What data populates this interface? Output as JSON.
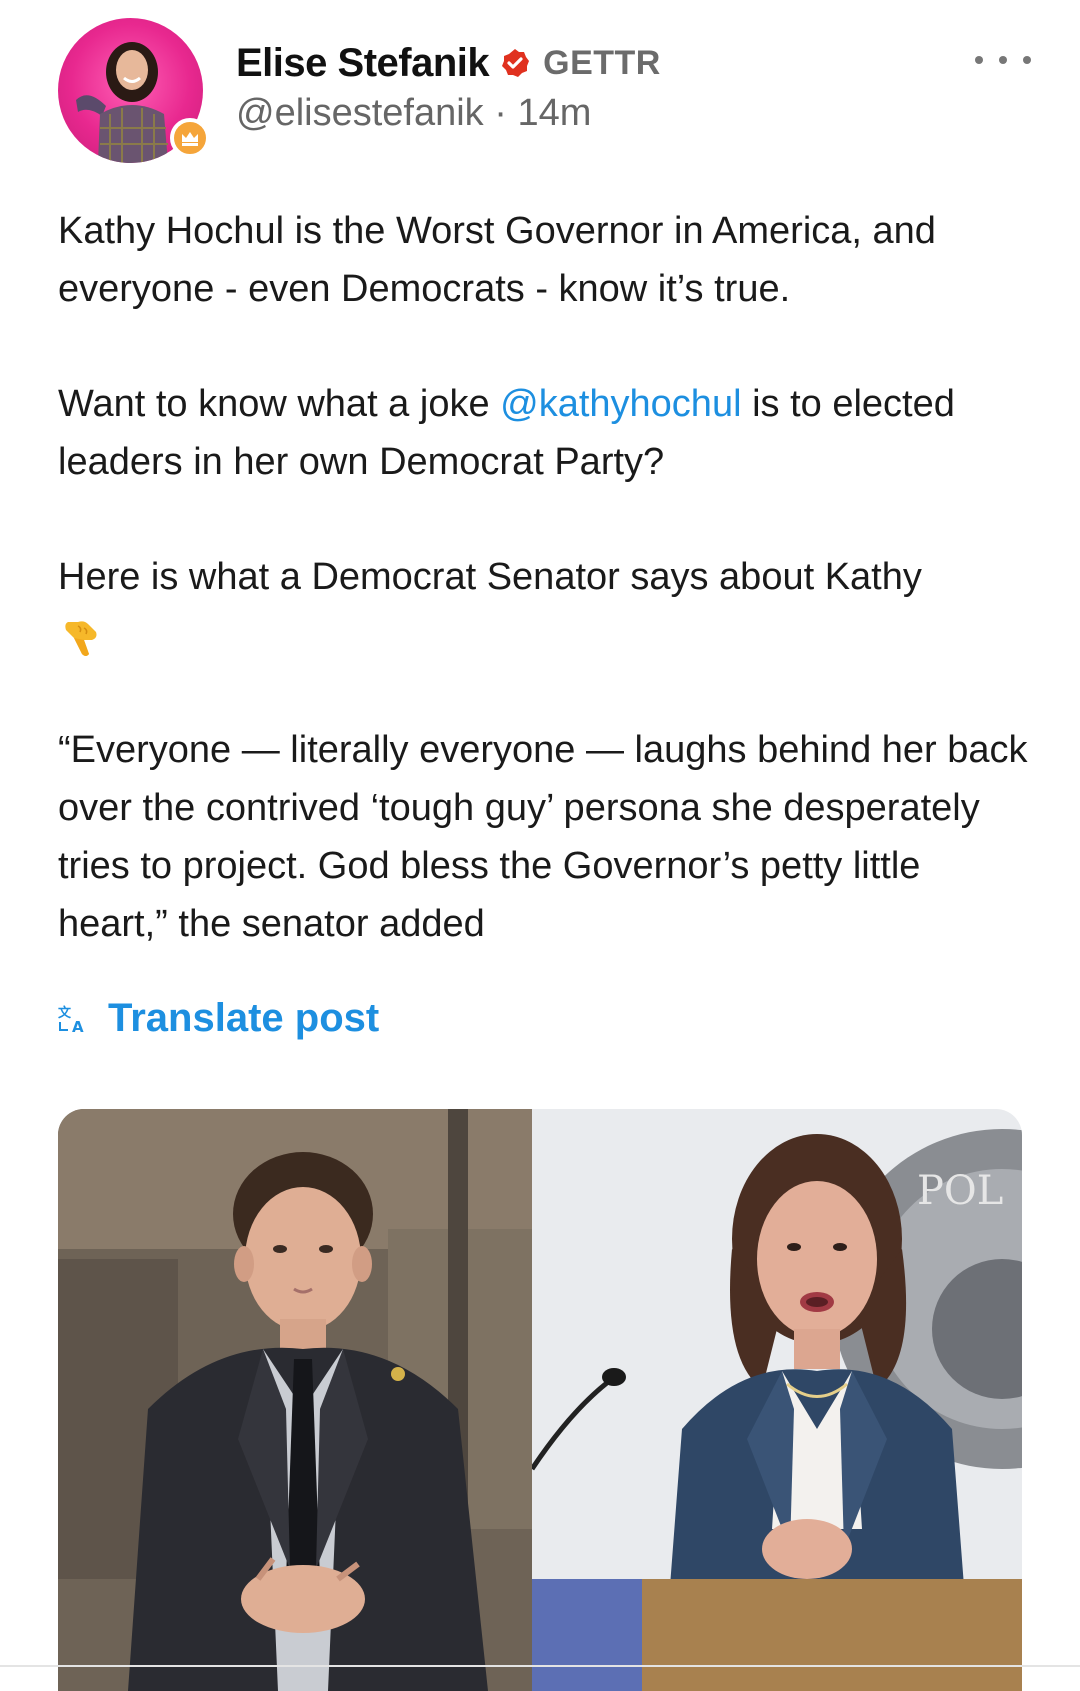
{
  "author": {
    "name": "Elise Stefanik",
    "platform": "GETTR",
    "handle": "@elisestefanik",
    "separator": "·",
    "time": "14m",
    "avatar_icon": "profile-avatar",
    "badge_icon": "crown-icon",
    "verified_icon": "verified-check-icon"
  },
  "post": {
    "para1": "Kathy Hochul is the Worst Governor in America, and everyone - even Democrats - know it’s true.",
    "para2_before": "Want to know what a joke ",
    "para2_mention": "@kathyhochul",
    "para2_after": " is to elected leaders in her own Democrat Party?",
    "para3": "Here is what a Democrat Senator says about Kathy",
    "para3_emoji": "👇",
    "para4": "“Everyone — literally everyone — laughs behind her back over the contrived ‘tough guy’ persona she desperately tries to project. God bless the Governor’s petty little heart,” the senator added"
  },
  "actions": {
    "translate_label": "Translate post",
    "translate_icon": "translate-icon",
    "more_icon": "more-options-icon"
  },
  "media": {
    "left_photo": "man-in-suit-photo",
    "right_photo": "woman-at-podium-photo",
    "seal_text": "POL"
  },
  "colors": {
    "accent": "#1d8fe0",
    "verified": "#e0311f",
    "avatar_bg": "#e8288f",
    "badge": "#f5a53a"
  }
}
